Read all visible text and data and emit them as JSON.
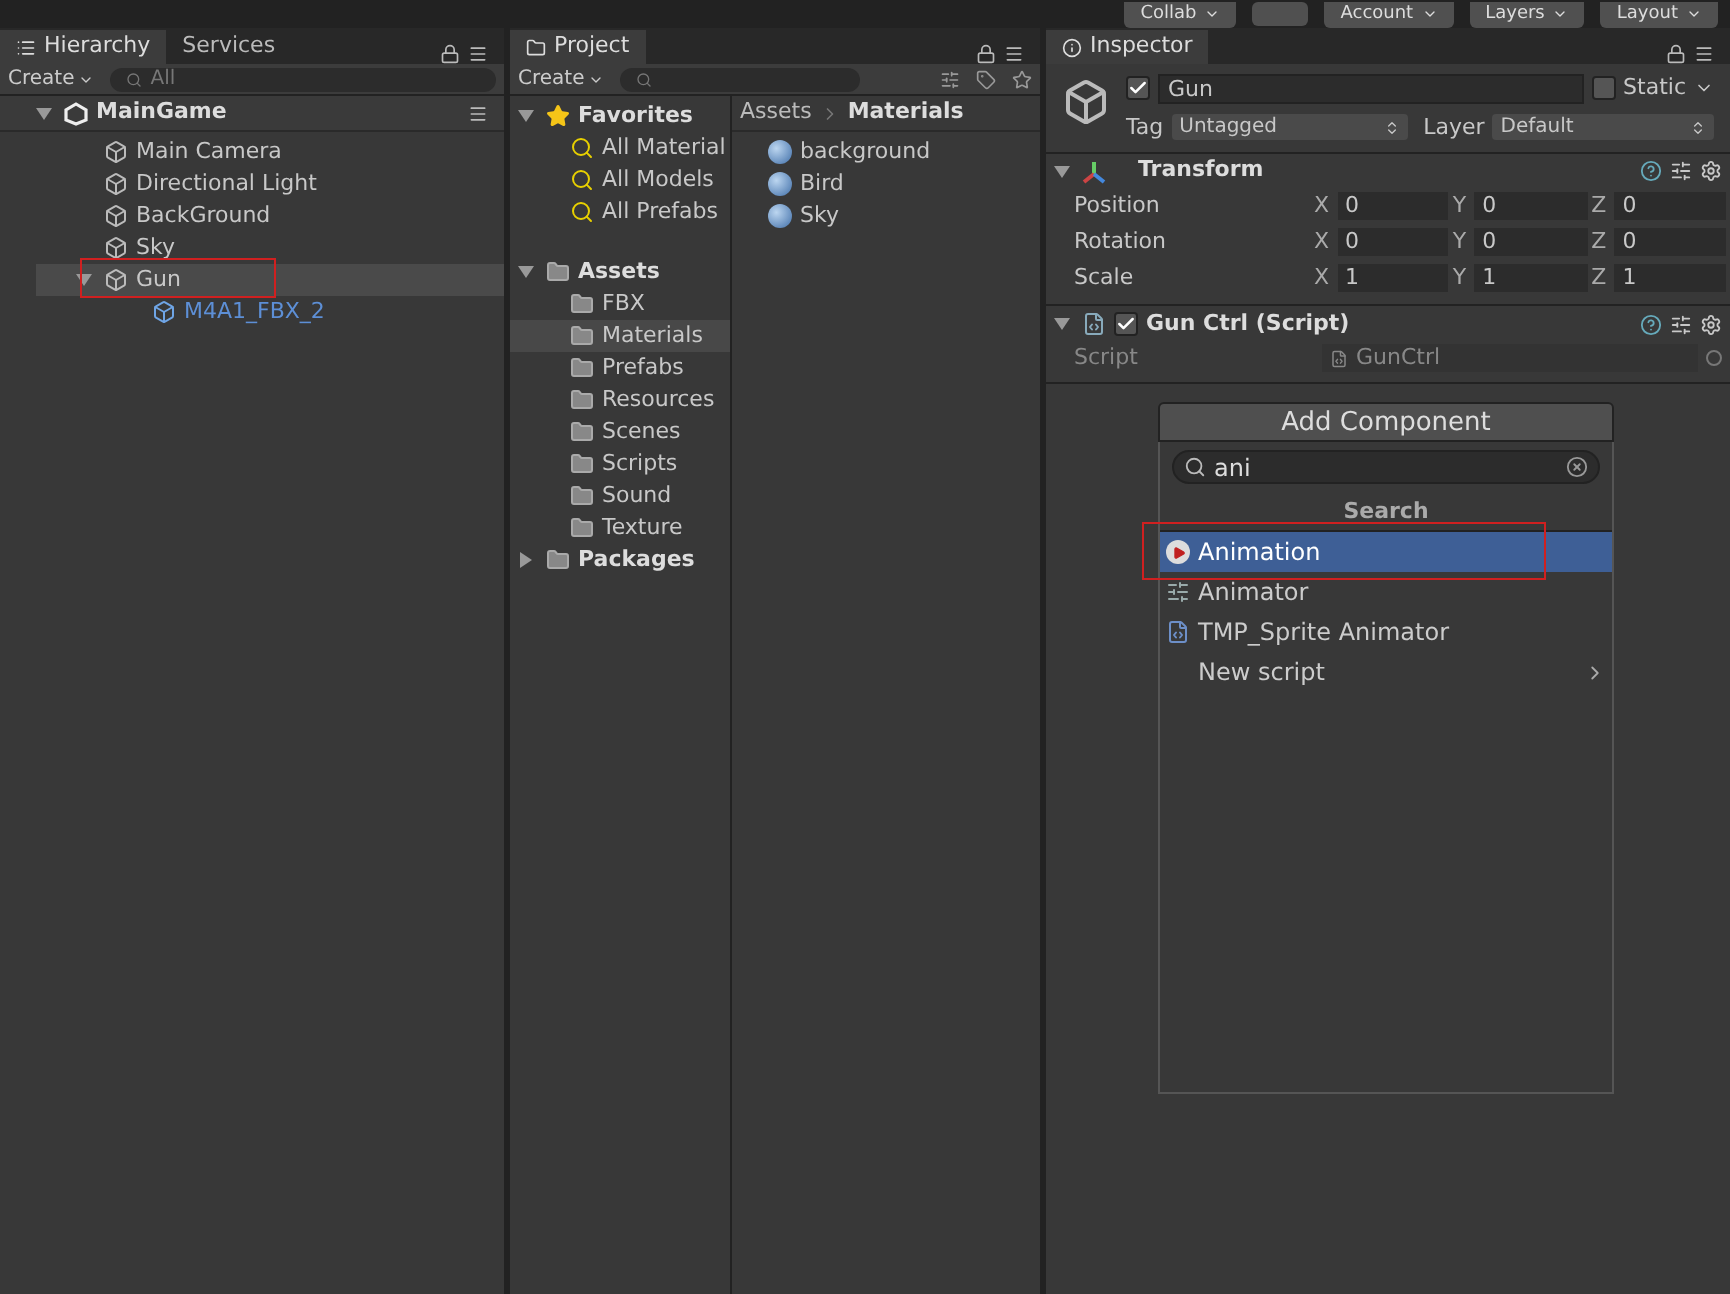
{
  "toolbar": {
    "buttons": [
      {
        "label": "Collab"
      },
      {
        "label": "Account"
      },
      {
        "label": "Layers"
      },
      {
        "label": "Layout"
      }
    ]
  },
  "hierarchy": {
    "tabs": [
      {
        "label": "Hierarchy",
        "selected": true
      },
      {
        "label": "Services",
        "selected": false
      }
    ],
    "create": "Create",
    "search_placeholder": "All",
    "scene": {
      "label": "MainGame",
      "expanded": true
    },
    "items": [
      {
        "label": "Main Camera",
        "kind": "gameobject",
        "selected": false,
        "highlighted": false
      },
      {
        "label": "Directional Light",
        "kind": "gameobject",
        "selected": false,
        "highlighted": false
      },
      {
        "label": "BackGround",
        "kind": "gameobject",
        "selected": false,
        "highlighted": false
      },
      {
        "label": "Sky",
        "kind": "gameobject",
        "selected": false,
        "highlighted": false
      },
      {
        "label": "Gun",
        "kind": "gameobject",
        "selected": true,
        "highlighted": true,
        "expanded": true,
        "children": [
          {
            "label": "M4A1_FBX_2",
            "kind": "prefab",
            "selected": false,
            "highlighted": false
          }
        ]
      }
    ]
  },
  "project": {
    "tab": "Project",
    "create": "Create",
    "favorites": {
      "label": "Favorites",
      "expanded": true,
      "items": [
        "All Material",
        "All Models",
        "All Prefabs"
      ]
    },
    "assets": {
      "label": "Assets",
      "expanded": true,
      "children": [
        {
          "label": "FBX",
          "selected": false
        },
        {
          "label": "Materials",
          "selected": true
        },
        {
          "label": "Prefabs",
          "selected": false
        },
        {
          "label": "Resources",
          "selected": false
        },
        {
          "label": "Scenes",
          "selected": false
        },
        {
          "label": "Scripts",
          "selected": false
        },
        {
          "label": "Sound",
          "selected": false
        },
        {
          "label": "Texture",
          "selected": false
        }
      ]
    },
    "packages": {
      "label": "Packages",
      "expanded": false
    },
    "breadcrumb": [
      "Assets",
      "Materials"
    ],
    "files": [
      "background",
      "Bird",
      "Sky"
    ]
  },
  "inspector": {
    "tab": "Inspector",
    "object": {
      "name": "Gun",
      "active": true,
      "static": false,
      "static_label": "Static",
      "tag_label": "Tag",
      "tag": "Untagged",
      "layer_label": "Layer",
      "layer": "Default"
    },
    "transform": {
      "title": "Transform",
      "expanded": true,
      "rows": [
        {
          "label": "Position",
          "values": [
            {
              "axis": "X",
              "value": "0"
            },
            {
              "axis": "Y",
              "value": "0"
            },
            {
              "axis": "Z",
              "value": "0"
            }
          ]
        },
        {
          "label": "Rotation",
          "values": [
            {
              "axis": "X",
              "value": "0"
            },
            {
              "axis": "Y",
              "value": "0"
            },
            {
              "axis": "Z",
              "value": "0"
            }
          ]
        },
        {
          "label": "Scale",
          "values": [
            {
              "axis": "X",
              "value": "1"
            },
            {
              "axis": "Y",
              "value": "1"
            },
            {
              "axis": "Z",
              "value": "1"
            }
          ]
        }
      ]
    },
    "script": {
      "title": "Gun Ctrl (Script)",
      "expanded": true,
      "enabled": true,
      "field_label": "Script",
      "value": "GunCtrl"
    },
    "add_component": {
      "button": "Add Component",
      "search": "ani",
      "header": "Search",
      "results": [
        {
          "label": "Animation",
          "kind": "animation",
          "selected": true,
          "highlighted": true,
          "submenu": false
        },
        {
          "label": "Animator",
          "kind": "animator",
          "selected": false,
          "highlighted": false,
          "submenu": false
        },
        {
          "label": "TMP_Sprite Animator",
          "kind": "script",
          "selected": false,
          "highlighted": false,
          "submenu": false
        },
        {
          "label": "New script",
          "kind": "none",
          "selected": false,
          "highlighted": false,
          "submenu": true
        }
      ]
    }
  }
}
